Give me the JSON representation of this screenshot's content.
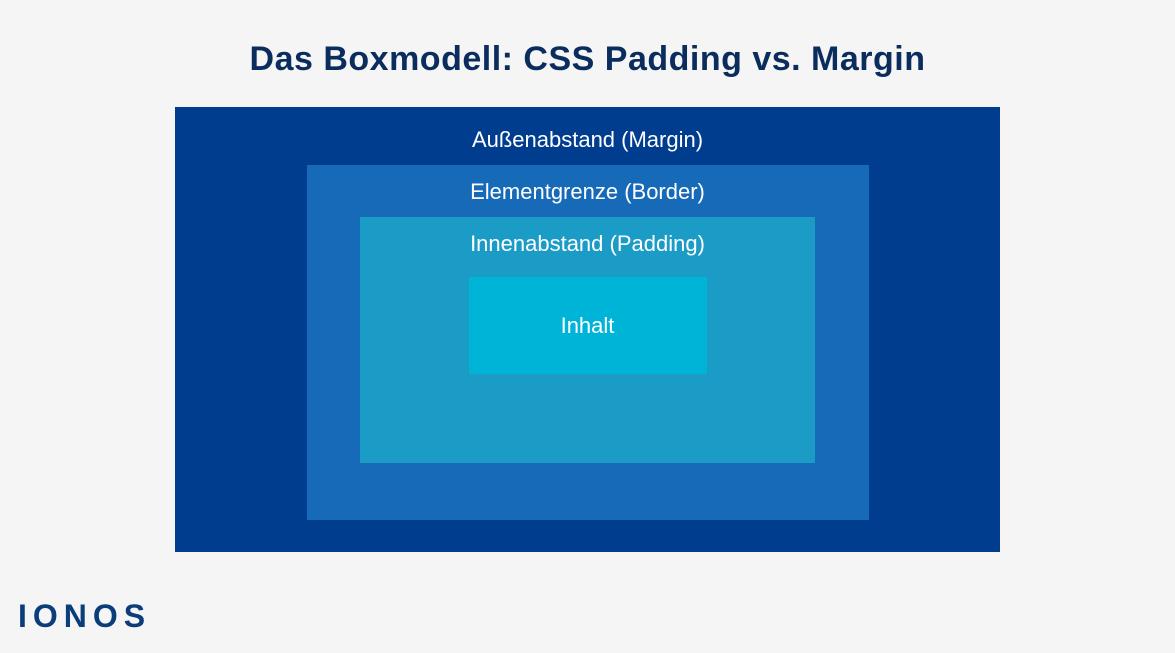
{
  "title": "Das Boxmodell: CSS Padding vs. Margin",
  "layers": {
    "margin": {
      "label": "Außenabstand (Margin)",
      "color": "#003d8f"
    },
    "border": {
      "label": "Elementgrenze (Border)",
      "color": "#166ab8"
    },
    "padding": {
      "label": "Innenabstand (Padding)",
      "color": "#1a9cc7"
    },
    "content": {
      "label": "Inhalt",
      "color": "#00b4d8"
    }
  },
  "brand": "IONOS"
}
